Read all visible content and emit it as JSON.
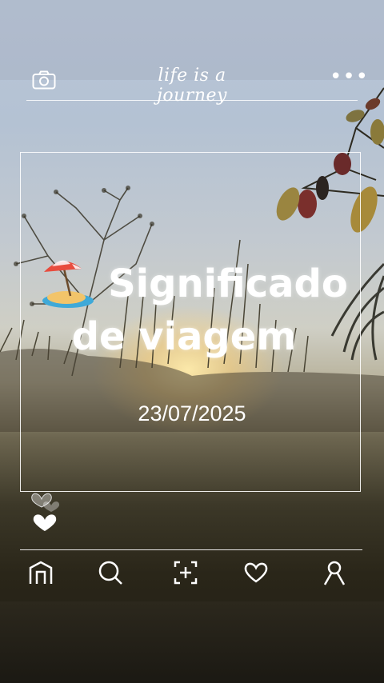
{
  "header": {
    "title": "life is a journey",
    "camera_icon": "camera-icon",
    "more_icon": "more-horizontal-icon"
  },
  "post": {
    "emoji": "beach-umbrella-icon",
    "title_line1": "Significado",
    "title_line2": "de viagem",
    "date": "23/07/2025"
  },
  "reactions": {
    "icons": [
      "heart-outline-icon",
      "heart-filled-icon"
    ]
  },
  "nav": {
    "items": [
      "home-icon",
      "search-icon",
      "add-icon",
      "heart-icon",
      "profile-icon"
    ]
  },
  "colors": {
    "accent": "#ffffff",
    "sky": "#b9c6d8",
    "sunset": "#ffe9aa",
    "ground": "#2a2619"
  }
}
